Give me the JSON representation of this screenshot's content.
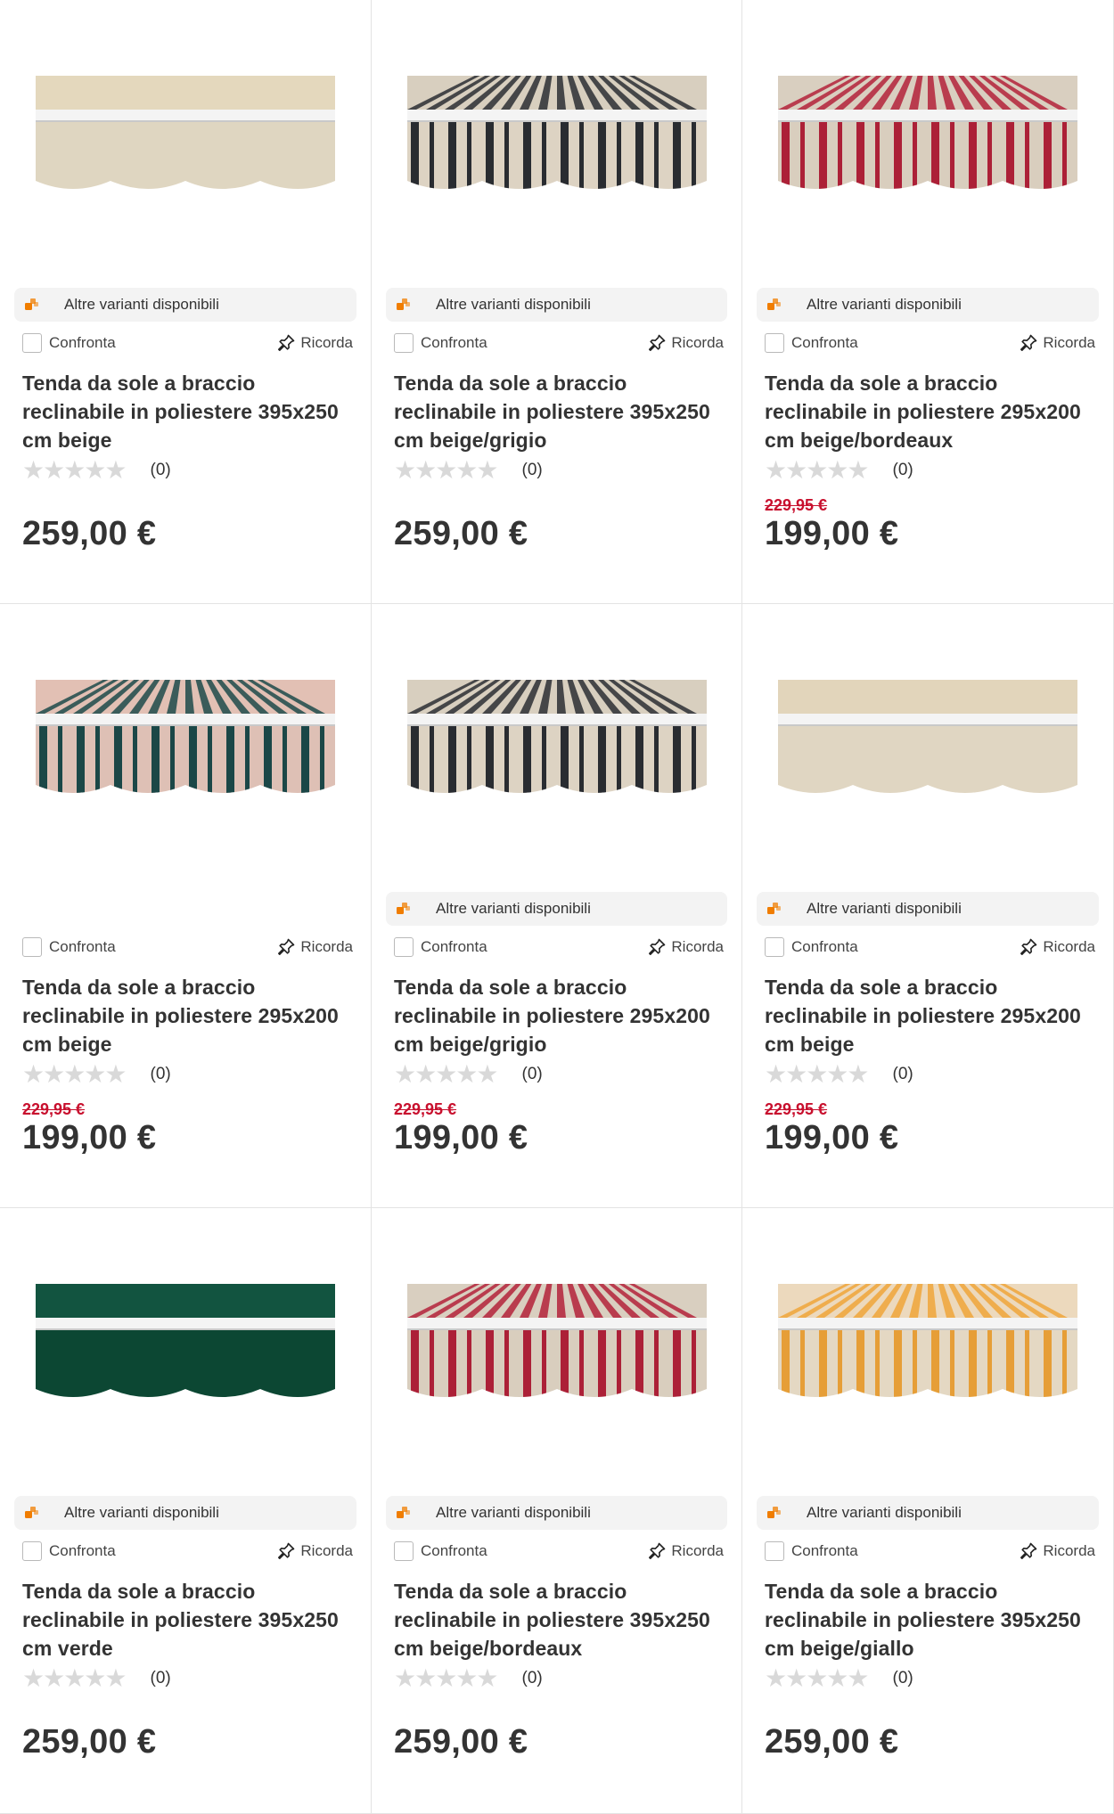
{
  "products": [
    {
      "variants_label": "Altre varianti disponibili",
      "compare_label": "Confronta",
      "remember_label": "Ricorda",
      "title_line1": "Tenda da sole a braccio",
      "title_line2": "reclinabile in poliestere 395x250",
      "title_line3": "cm beige",
      "rating_count": "(0)",
      "old_price": "",
      "price": "259,00 €",
      "image": {
        "style": "solid",
        "base": "#e9dfc9",
        "top": "#e4d8bd",
        "stripe": ""
      }
    },
    {
      "variants_label": "Altre varianti disponibili",
      "compare_label": "Confronta",
      "remember_label": "Ricorda",
      "title_line1": "Tenda da sole a braccio",
      "title_line2": "reclinabile in poliestere 395x250",
      "title_line3": "cm beige/grigio",
      "rating_count": "(0)",
      "old_price": "",
      "price": "259,00 €",
      "image": {
        "style": "striped",
        "base": "#e6dccb",
        "top": "#d8cfbf",
        "stripe": "#2b2e33"
      }
    },
    {
      "variants_label": "Altre varianti disponibili",
      "compare_label": "Confronta",
      "remember_label": "Ricorda",
      "title_line1": "Tenda da sole a braccio",
      "title_line2": "reclinabile in poliestere 295x200",
      "title_line3": "cm beige/bordeaux",
      "rating_count": "(0)",
      "old_price": "229,95 €",
      "price": "199,00 €",
      "image": {
        "style": "striped",
        "base": "#e2d7c6",
        "top": "#d9cfc0",
        "stripe": "#b3223a"
      }
    },
    {
      "variants_label": "",
      "compare_label": "Confronta",
      "remember_label": "Ricorda",
      "title_line1": "Tenda da sole a braccio",
      "title_line2": "reclinabile in poliestere 295x200",
      "title_line3": "cm beige",
      "rating_count": "(0)",
      "old_price": "229,95 €",
      "price": "199,00 €",
      "image": {
        "style": "striped",
        "base": "#e8c8bd",
        "top": "#e2c0b4",
        "stripe": "#1d4a4a"
      }
    },
    {
      "variants_label": "Altre varianti disponibili",
      "compare_label": "Confronta",
      "remember_label": "Ricorda",
      "title_line1": "Tenda da sole a braccio",
      "title_line2": "reclinabile in poliestere 295x200",
      "title_line3": "cm beige/grigio",
      "rating_count": "(0)",
      "old_price": "229,95 €",
      "price": "199,00 €",
      "image": {
        "style": "striped",
        "base": "#e6dccb",
        "top": "#d8cfbf",
        "stripe": "#2b2e33"
      }
    },
    {
      "variants_label": "Altre varianti disponibili",
      "compare_label": "Confronta",
      "remember_label": "Ricorda",
      "title_line1": "Tenda da sole a braccio",
      "title_line2": "reclinabile in poliestere 295x200",
      "title_line3": "cm beige",
      "rating_count": "(0)",
      "old_price": "229,95 €",
      "price": "199,00 €",
      "image": {
        "style": "solid",
        "base": "#eadfca",
        "top": "#e2d5bb",
        "stripe": ""
      }
    },
    {
      "variants_label": "Altre varianti disponibili",
      "compare_label": "Confronta",
      "remember_label": "Ricorda",
      "title_line1": "Tenda da sole a braccio",
      "title_line2": "reclinabile in poliestere 395x250",
      "title_line3": "cm verde",
      "rating_count": "(0)",
      "old_price": "",
      "price": "259,00 €",
      "image": {
        "style": "solid",
        "base": "#0d4a36",
        "top": "#125440",
        "stripe": ""
      }
    },
    {
      "variants_label": "Altre varianti disponibili",
      "compare_label": "Confronta",
      "remember_label": "Ricorda",
      "title_line1": "Tenda da sole a braccio",
      "title_line2": "reclinabile in poliestere 395x250",
      "title_line3": "cm beige/bordeaux",
      "rating_count": "(0)",
      "old_price": "",
      "price": "259,00 €",
      "image": {
        "style": "striped",
        "base": "#e2d7c6",
        "top": "#d9cfc0",
        "stripe": "#b3223a"
      }
    },
    {
      "variants_label": "Altre varianti disponibili",
      "compare_label": "Confronta",
      "remember_label": "Ricorda",
      "title_line1": "Tenda da sole a braccio",
      "title_line2": "reclinabile in poliestere 395x250",
      "title_line3": "cm beige/giallo",
      "rating_count": "(0)",
      "old_price": "",
      "price": "259,00 €",
      "image": {
        "style": "striped",
        "base": "#eee1cb",
        "top": "#ecd9bd",
        "stripe": "#f0a53a"
      }
    }
  ],
  "colors": {
    "variants_icon": "#f07d00",
    "old_price": "#c8102e",
    "star_empty": "#d9d9d9"
  }
}
